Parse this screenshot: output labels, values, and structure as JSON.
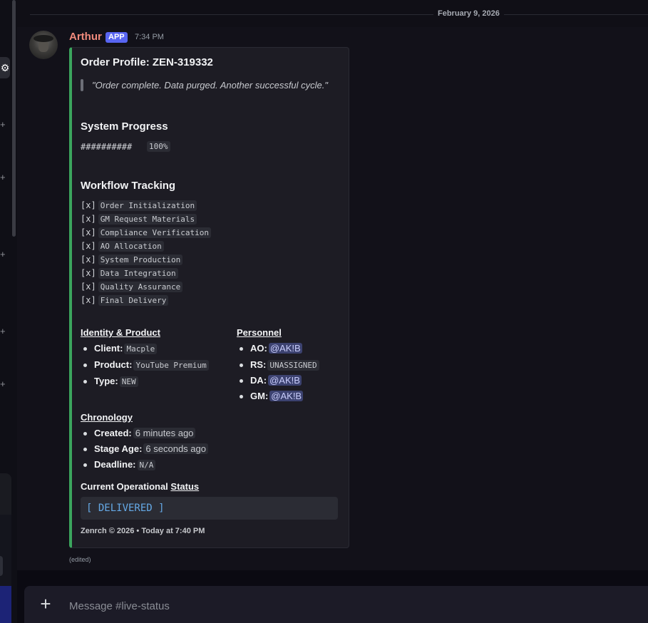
{
  "date_divider": "February 9, 2026",
  "message": {
    "author": "Arthur",
    "app_tag": "APP",
    "time": "7:34 PM",
    "edited": "(edited)"
  },
  "embed": {
    "accent_color": "#3ba55d",
    "title": "Order Profile: ZEN-319332",
    "quote": "\"Order complete. Data purged. Another successful cycle.\"",
    "progress_heading": "System Progress",
    "progress_bar": "##########",
    "progress_percent": "100%",
    "workflow_heading": "Workflow Tracking",
    "workflow": [
      {
        "mark": "[x]",
        "label": "Order Initialization"
      },
      {
        "mark": "[x]",
        "label": "GM Request Materials"
      },
      {
        "mark": "[x]",
        "label": "Compliance Verification"
      },
      {
        "mark": "[x]",
        "label": "AO Allocation"
      },
      {
        "mark": "[x]",
        "label": "System Production"
      },
      {
        "mark": "[x]",
        "label": "Data Integration"
      },
      {
        "mark": "[x]",
        "label": "Quality Assurance"
      },
      {
        "mark": "[x]",
        "label": "Final Delivery"
      }
    ],
    "identity_heading": "Identity & Product",
    "identity": [
      {
        "key": "Client:",
        "value": "Macple"
      },
      {
        "key": "Product:",
        "value": "YouTube Premium"
      },
      {
        "key": "Type:",
        "value": "NEW"
      }
    ],
    "personnel_heading": "Personnel",
    "personnel": [
      {
        "key": "AO:",
        "value": "@AK!B"
      },
      {
        "key": "RS:",
        "value": "UNASSIGNED"
      },
      {
        "key": "DA:",
        "value": "@AK!B"
      },
      {
        "key": "GM:",
        "value": "@AK!B"
      }
    ],
    "chronology_heading": "Chronology",
    "chronology": [
      {
        "key": "Created:",
        "value": "6 minutes ago"
      },
      {
        "key": "Stage Age:",
        "value": "6 seconds ago"
      },
      {
        "key": "Deadline:",
        "value": "N/A"
      }
    ],
    "status_heading_prefix": "Current Operational",
    "status_heading_link": "Status",
    "status_value": "[ DELIVERED ]",
    "footer": "Zenrch © 2026 • Today at 7:40 PM"
  },
  "composer": {
    "placeholder": "Message #live-status"
  },
  "icons": {
    "rail_settings": "gear-icon",
    "rail_add": "plus-icon",
    "composer_add": "plus-icon"
  }
}
